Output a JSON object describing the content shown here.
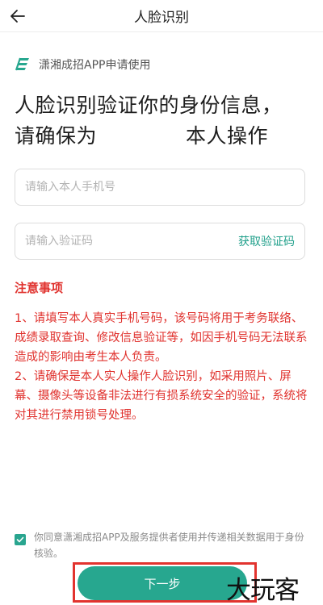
{
  "header": {
    "title": "人脸识别"
  },
  "app": {
    "label": "潇湘成招APP申请使用",
    "accent": "#27a78f"
  },
  "headline": {
    "line1": "人脸识别验证你的身份信息，",
    "line2_prefix": "请确保为",
    "line2_suffix": "本人操作"
  },
  "form": {
    "phone_placeholder": "请输入本人手机号",
    "phone_value": "",
    "code_placeholder": "请输入验证码",
    "code_value": "",
    "get_code_label": "获取验证码"
  },
  "notice": {
    "title": "注意事项",
    "item1": "1、请填写本人真实手机号码，该号码将用于考务联络、成绩录取查询、修改信息验证等，如因手机号码无法联系造成的影响由考生本人负责。",
    "item2": " 2、请确保是本人实人操作人脸识别，如采用照片、屏幕、摄像头等设备非法进行有损系统安全的验证，系统将对其进行禁用锁号处理。",
    "color": "#e0322e"
  },
  "consent": {
    "checked": true,
    "text": "你同意潇湘成招APP及服务提供者使用并传递相关数据用于身份核验。"
  },
  "footer": {
    "next_label": "下一步"
  },
  "watermark": {
    "text": "大玩客"
  }
}
